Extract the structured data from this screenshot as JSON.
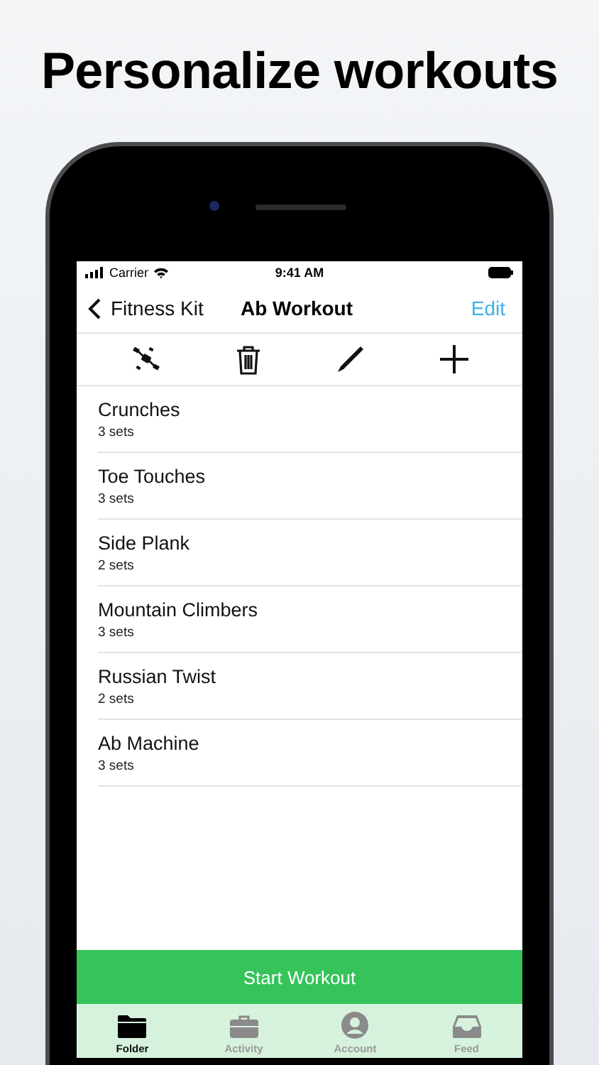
{
  "headline": "Personalize workouts",
  "status_bar": {
    "carrier": "Carrier",
    "time": "9:41 AM"
  },
  "nav": {
    "back": "Fitness Kit",
    "title": "Ab Workout",
    "action": "Edit"
  },
  "exercises": [
    {
      "name": "Crunches",
      "detail": "3 sets"
    },
    {
      "name": "Toe Touches",
      "detail": "3 sets"
    },
    {
      "name": "Side Plank",
      "detail": "2 sets"
    },
    {
      "name": "Mountain Climbers",
      "detail": "3 sets"
    },
    {
      "name": "Russian Twist",
      "detail": "2 sets"
    },
    {
      "name": "Ab Machine",
      "detail": "3 sets"
    }
  ],
  "start_button": "Start Workout",
  "tabs": [
    {
      "label": "Folder",
      "kind": "folder",
      "selected": true
    },
    {
      "label": "Activity",
      "kind": "briefcase",
      "selected": false
    },
    {
      "label": "Account",
      "kind": "person",
      "selected": false
    },
    {
      "label": "Feed",
      "kind": "tray",
      "selected": false
    }
  ]
}
